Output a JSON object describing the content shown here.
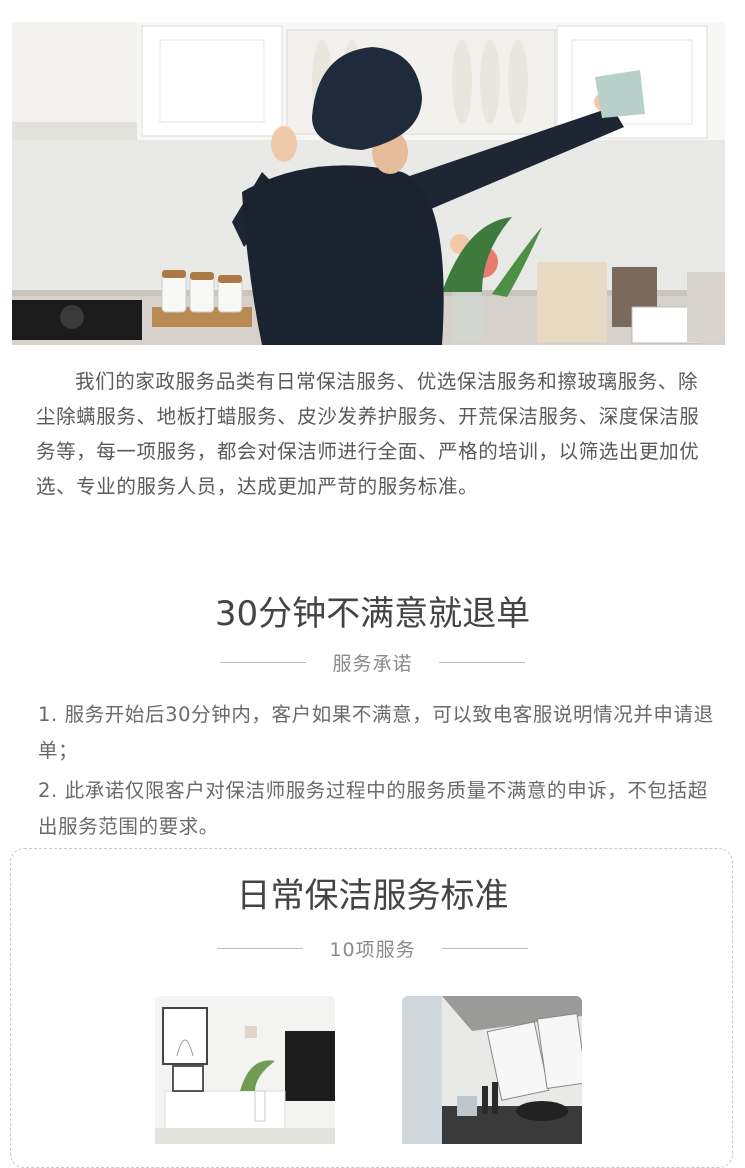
{
  "intro": {
    "text": "我们的家政服务品类有日常保洁服务、优选保洁服务和擦玻璃服务、除尘除螨服务、地板打蜡服务、皮沙发养护服务、开荒保洁服务、深度保洁服务等，每一项服务，都会对保洁师进行全面、严格的培训，以筛选出更加优选、专业的服务人员，达成更加严苛的服务标准。"
  },
  "guarantee": {
    "title": "30分钟不满意就退单",
    "subtitle": "服务承诺",
    "items": [
      "1. 服务开始后30分钟内，客户如果不满意，可以致电客服说明情况并申请退单；",
      "2. 此承诺仅限客户对保洁师服务过程中的服务质量不满意的申诉，不包括超出服务范围的要求。"
    ]
  },
  "standard": {
    "title": "日常保洁服务标准",
    "subtitle": "10项服务"
  },
  "colors": {
    "heading": "#444444",
    "body_text": "#5a5a5a",
    "muted": "#8a8a8a",
    "rule": "#bbbbbb",
    "uniform": "#1e2633"
  }
}
